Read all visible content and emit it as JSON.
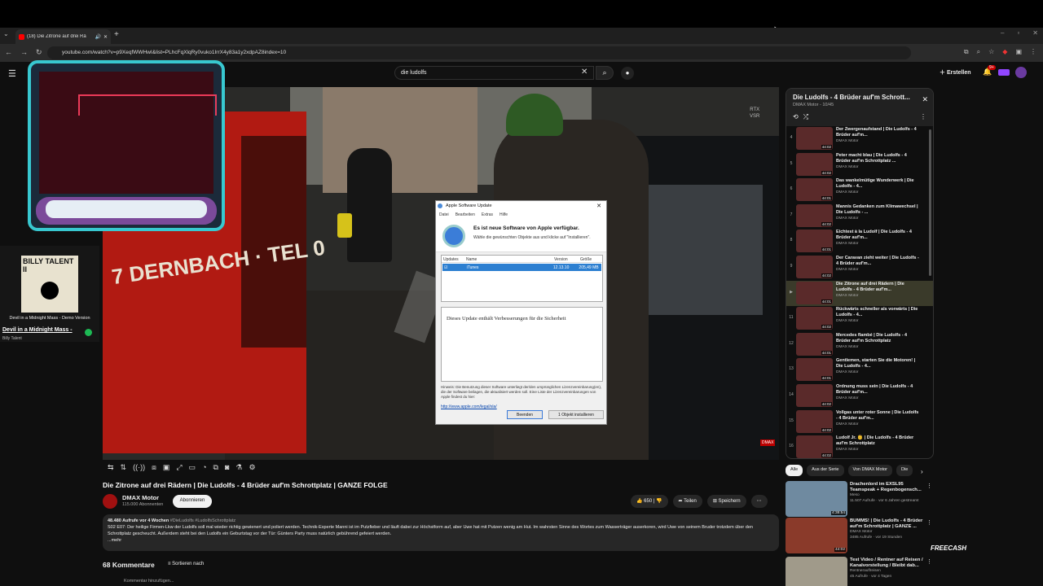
{
  "browser": {
    "tab_title": "(18) Die Zitrone auf drei Rä",
    "new_tab": "+",
    "url": "youtube.com/watch?v=p9XeqfWWHwI&list=PLhcFqXlqRy0vuko1IrrX4y83a1y2xdpAZ8index=10",
    "win_controls": [
      "–",
      "▫",
      "✕"
    ]
  },
  "youtube": {
    "search_value": "die ludolfs",
    "create_label": "Erstellen",
    "notif_count": "9+"
  },
  "video": {
    "rtx_label": "RTX\nVSR",
    "truck_text": "7 DERNBACH · TEL 0",
    "dmax_bug": "DMAX",
    "title": "Die Zitrone auf drei Rädern | Die Ludolfs - 4 Brüder auf'm Schrottplatz | GANZE FOLGE",
    "channel": "DMAX Motor",
    "subs": "115.000 Abonnenten",
    "subscribe": "Abonnieren",
    "likes": "650",
    "share": "Teilen",
    "save": "Speichern",
    "desc_meta": "48.480 Aufrufe  vor 4 Wochen",
    "desc_tags": "#DieLudolfs #LudolfsSchrottplatz",
    "desc_text": "S02 E07: Der heilige Firmen-Lkw der Ludolfs soll mal wieder richtig gewienert und poliert werden. Technik-Experte Manni ist im Putzfieber und läuft dabei zur Höchstform auf, aber Uwe hat mit Putzen wenig am Hut. Im wahrsten Sinne des Wortes zum Wasserträger auserkoren, wird Uwe von seinem Bruder trotzdem über den Schrottplatz gescheucht. Außerdem steht bei den Ludolfs ein Geburtstag vor der Tür: Günters Party muss natürlich gebührend gefeiert werden.",
    "desc_more": "...mehr",
    "comments_count": "68 Kommentare",
    "sort_by": "Sortieren nach",
    "add_comment": "Kommentar hinzufügen..."
  },
  "spotify": {
    "album_text": "BILLY TALENT II",
    "demo": "Devil in a Midnight Mass - Demo Version",
    "track": "Devil in a Midnight Mass -",
    "artist": "Billy Talent"
  },
  "dialog": {
    "title": "Apple Software Update",
    "menu": [
      "Datei",
      "Bearbeiten",
      "Extras",
      "Hilfe"
    ],
    "heading": "Es ist neue Software von Apple verfügbar.",
    "subheading": "Wähle die gewünschten Objekte aus und klicke auf \"Installieren\".",
    "col_updates": "Updates",
    "col_name": "Name",
    "col_version": "Version",
    "col_size": "Größe",
    "row_name": "iTunes",
    "row_version": "12.13.10",
    "row_size": "205,49 MB",
    "description": "Dieses Update enthält Verbesserungen für die Sicherheit",
    "note": "Hinweis: Die Benutzung dieser Software unterliegt der/den ursprünglichen Lizenzvereinbarung(en), die der Software beilagen, die aktualisiert werden soll. Eine Liste der Lizenzvereinbarungen von Apple findest du hier:",
    "link": "http://www.apple.com/legal/sla/",
    "btn_quit": "Beenden",
    "btn_install": "1 Objekt installieren"
  },
  "playlist": {
    "title": "Die Ludolfs - 4 Brüder auf'm Schrott...",
    "sub": "DMAX Motor - 10/45",
    "items": [
      {
        "num": "4",
        "title": "Der Zwergenaufstand | Die Ludolfs - 4 Brüder auf'm...",
        "ch": "DMAX Motor",
        "dur": "44:02"
      },
      {
        "num": "5",
        "title": "Peter macht blau | Die Ludolfs - 4 Brüder auf'm Schrottplatz ...",
        "ch": "DMAX Motor",
        "dur": "44:02"
      },
      {
        "num": "6",
        "title": "Das wankelmütige Wunderwerk | Die Ludolfs - 4...",
        "ch": "DMAX Motor",
        "dur": "44:01"
      },
      {
        "num": "7",
        "title": "Mannis Gedanken zum Klimawechsel | Die Ludolfs - ...",
        "ch": "DMAX Motor",
        "dur": "44:02"
      },
      {
        "num": "8",
        "title": "Eichtest à la Ludolf | Die Ludolfs - 4 Brüder auf'm...",
        "ch": "DMAX Motor",
        "dur": "44:01"
      },
      {
        "num": "9",
        "title": "Der Caravan zieht weiter | Die Ludolfs - 4 Brüder auf'm...",
        "ch": "DMAX Motor",
        "dur": "44:02"
      },
      {
        "num": "▶",
        "title": "Die Zitrone auf drei Rädern | Die Ludolfs - 4 Brüder auf'm...",
        "ch": "DMAX Motor",
        "dur": "44:01"
      },
      {
        "num": "11",
        "title": "Rückwärts schneller als vorwärts | Die Ludolfs - 4...",
        "ch": "DMAX Motor",
        "dur": "44:02"
      },
      {
        "num": "12",
        "title": "Mercedes flambé | Die Ludolfs - 4 Brüder auf'm Schrottplatz",
        "ch": "DMAX Motor",
        "dur": "44:01"
      },
      {
        "num": "13",
        "title": "Gentlemen, starten Sie die Motoren! | Die Ludolfs - 4...",
        "ch": "DMAX Motor",
        "dur": "44:01"
      },
      {
        "num": "14",
        "title": "Ordnung muss sein | Die Ludolfs - 4 Brüder auf'm...",
        "ch": "DMAX Motor",
        "dur": "44:02"
      },
      {
        "num": "15",
        "title": "Vollgas unter roter Sonne | Die Ludolfs - 4 Brüder auf'm...",
        "ch": "DMAX Motor",
        "dur": "44:02"
      },
      {
        "num": "16",
        "title": "Ludolf Jr. 👶 | Die Ludolfs - 4 Brüder auf'm Schrottplatz",
        "ch": "DMAX Motor",
        "dur": "44:02"
      }
    ]
  },
  "chips": [
    "Alle",
    "Aus der Serie",
    "Von DMAX Motor",
    "Die"
  ],
  "recs": [
    {
      "title": "Drachenlord im EXSL95 Teamspeak + Regenbogensch...",
      "m1": "Meso",
      "m2": "11.507 Aufrufe · vor 6 Jahren gestreamt",
      "dur": "4:38:54"
    },
    {
      "title": "BUMMS! | Die Ludolfs - 4 Brüder auf'm Schrottplatz | GANZE ...",
      "m1": "DMAX Motor",
      "m2": "3485 Aufrufe · vor 19 Stunden",
      "dur": "44:02"
    },
    {
      "title": "Test Video / Rentner auf Reisen / Kanalvorstellung / Bleibt dab...",
      "m1": "Rentnerauflreisen",
      "m2": "45 Aufrufe · vor 4 Tagen",
      "dur": ""
    }
  ],
  "freecash": "FREECASH",
  "colors": {
    "accent": "#ff0000",
    "dialog_select": "#2c7fd1",
    "twitch": "#9146ff"
  }
}
